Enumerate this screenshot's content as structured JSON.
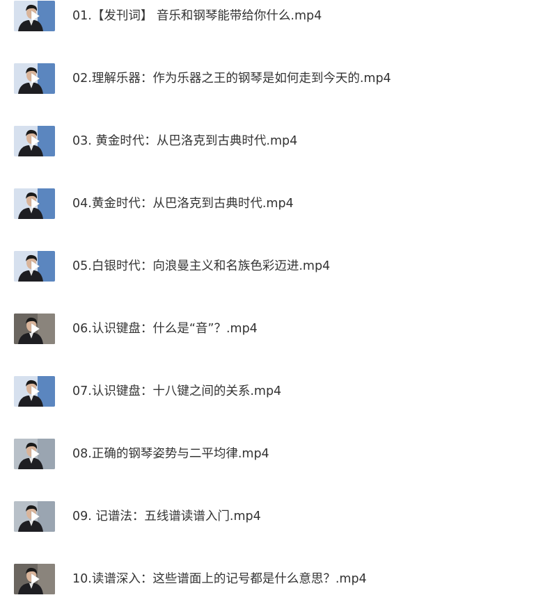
{
  "files": [
    {
      "name": "01.【发刊词】 音乐和钢琴能带给你什么.mp4",
      "thumb_style": "blue"
    },
    {
      "name": "02.理解乐器：作为乐器之王的钢琴是如何走到今天的.mp4",
      "thumb_style": "blue"
    },
    {
      "name": "03. 黄金时代：从巴洛克到古典时代.mp4",
      "thumb_style": "blue"
    },
    {
      "name": "04.黄金时代：从巴洛克到古典时代.mp4",
      "thumb_style": "blue"
    },
    {
      "name": "05.白银时代：向浪曼主义和名族色彩迈进.mp4",
      "thumb_style": "blue"
    },
    {
      "name": "06.认识键盘：什么是“音”？.mp4",
      "thumb_style": "dark"
    },
    {
      "name": "07.认识键盘：十八键之间的关系.mp4",
      "thumb_style": "blue"
    },
    {
      "name": "08.正确的钢琴姿势与二平均律.mp4",
      "thumb_style": "mid"
    },
    {
      "name": "09. 记谱法：五线谱读谱入门.mp4",
      "thumb_style": "mid"
    },
    {
      "name": "10.读谱深入：这些谱面上的记号都是什么意思？.mp4",
      "thumb_style": "dark"
    }
  ],
  "icons": {
    "thumbnail": "video-thumbnail-icon",
    "play": "play-icon"
  },
  "colors": {
    "text": "#333333",
    "play_fill": "#ffffff",
    "thumb_blue": "#c9d5e6",
    "thumb_dark": "#5d5a56",
    "thumb_mid": "#aab3bd"
  }
}
